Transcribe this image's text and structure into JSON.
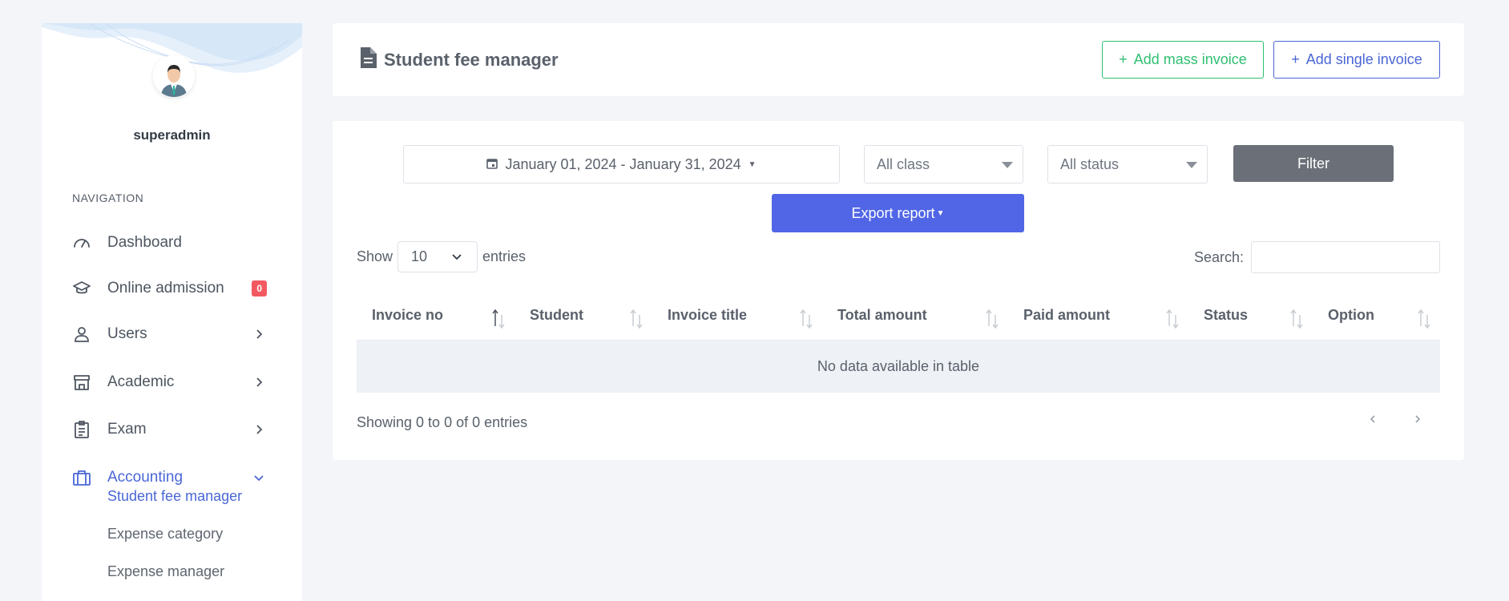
{
  "user": {
    "name": "superadmin"
  },
  "sidebar": {
    "heading": "NAVIGATION",
    "items": [
      {
        "label": "Dashboard",
        "icon": "speedometer-icon"
      },
      {
        "label": "Online admission",
        "icon": "graduation-cap-icon",
        "badge": "0"
      },
      {
        "label": "Users",
        "icon": "user-icon"
      },
      {
        "label": "Academic",
        "icon": "school-building-icon"
      },
      {
        "label": "Exam",
        "icon": "clipboard-icon"
      },
      {
        "label": "Accounting",
        "icon": "briefcase-icon"
      }
    ],
    "subitems": [
      {
        "label": "Student fee manager"
      },
      {
        "label": "Expense category"
      },
      {
        "label": "Expense manager"
      }
    ]
  },
  "header": {
    "title": "Student fee manager",
    "add_mass_label": "Add mass invoice",
    "add_single_label": "Add single invoice"
  },
  "filters": {
    "date_range": "January 01, 2024 - January 31, 2024",
    "class_value": "All class",
    "status_value": "All status",
    "filter_label": "Filter",
    "export_label": "Export report"
  },
  "table": {
    "show_label": "Show",
    "length_value": "10",
    "entries_label": "entries",
    "search_label": "Search:",
    "columns": [
      "Invoice no",
      "Student",
      "Invoice title",
      "Total amount",
      "Paid amount",
      "Status",
      "Option"
    ],
    "empty_message": "No data available in table",
    "info": "Showing 0 to 0 of 0 entries"
  },
  "colors": {
    "accent": "#4a66d6",
    "success": "#2fbf71",
    "export": "#5166e6",
    "filter": "#6b7078",
    "badge": "#f25961"
  }
}
